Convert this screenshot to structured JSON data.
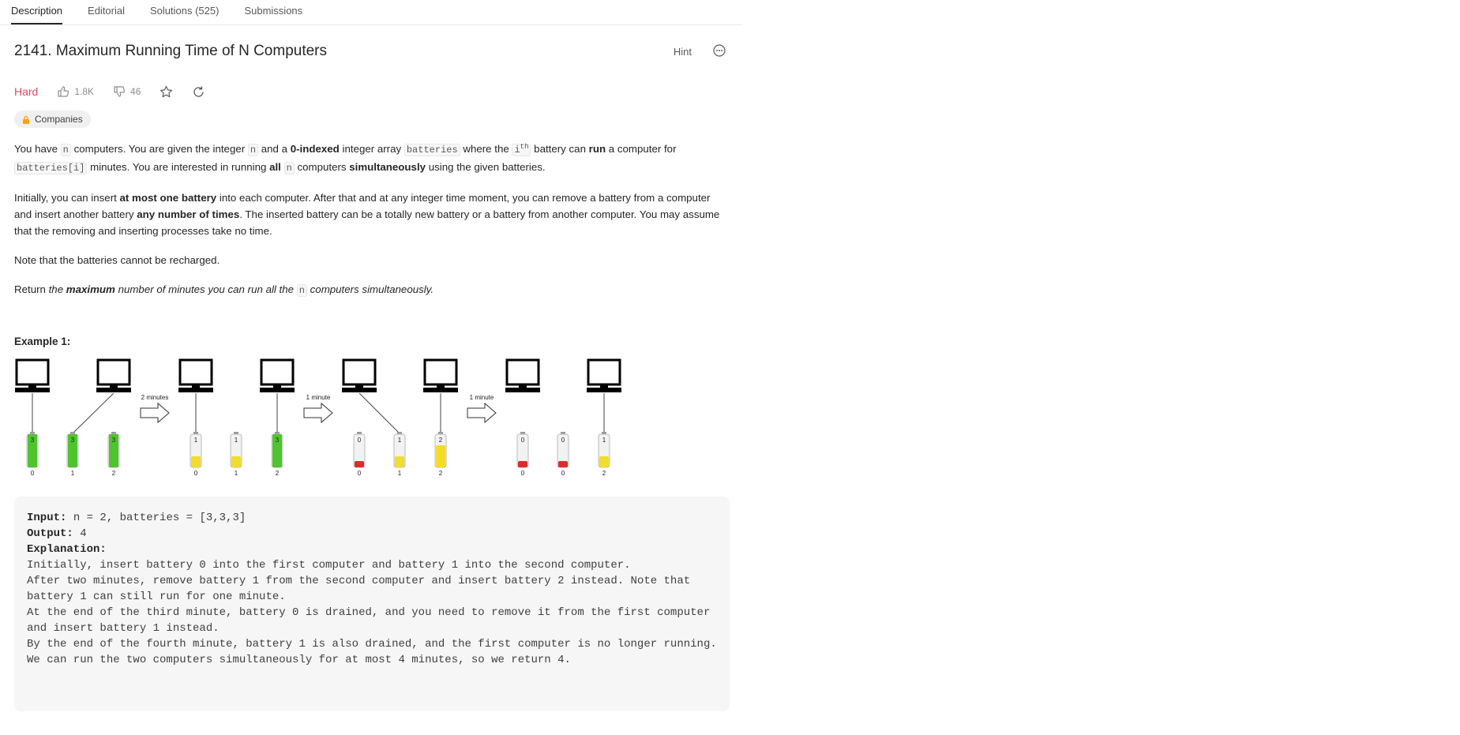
{
  "tabs": [
    {
      "label": "Description",
      "active": true
    },
    {
      "label": "Editorial",
      "active": false
    },
    {
      "label": "Solutions (525)",
      "active": false
    },
    {
      "label": "Submissions",
      "active": false
    }
  ],
  "problem": {
    "title": "2141. Maximum Running Time of N Computers",
    "hint_label": "Hint",
    "difficulty": "Hard",
    "likes": "1.8K",
    "dislikes": "46",
    "companies_label": "Companies"
  },
  "description": {
    "p1": {
      "t1": "You have ",
      "c1": "n",
      "t2": " computers. You are given the integer ",
      "c2": "n",
      "t3": " and a ",
      "b1": "0-indexed",
      "t4": " integer array ",
      "c3": "batteries",
      "t5": " where the ",
      "c4_base": "i",
      "c4_sup": "th",
      "t6": " battery can ",
      "b2": "run",
      "t7": " a computer for ",
      "c5": "batteries[i]",
      "t8": " minutes. You are interested in running ",
      "b3": "all",
      "t9": " ",
      "c6": "n",
      "t10": " computers ",
      "b4": "simultaneously",
      "t11": " using the given batteries."
    },
    "p2": {
      "t1": "Initially, you can insert ",
      "b1": "at most one battery",
      "t2": " into each computer. After that and at any integer time moment, you can remove a battery from a computer and insert another battery ",
      "b2": "any number of times",
      "t3": ". The inserted battery can be a totally new battery or a battery from another computer. You may assume that the removing and inserting processes take no time."
    },
    "p3": "Note that the batteries cannot be recharged.",
    "p4": {
      "t1": "Return ",
      "i1": "the ",
      "b1": "maximum",
      "i2": " number of minutes you can run all the ",
      "c1": "n",
      "i3": " computers simultaneously."
    }
  },
  "example": {
    "title": "Example 1:",
    "input_label": "Input:",
    "input_value": " n = 2, batteries = [3,3,3]",
    "output_label": "Output:",
    "output_value": " 4",
    "explanation_label": "Explanation:",
    "explanation_text": "Initially, insert battery 0 into the first computer and battery 1 into the second computer.\nAfter two minutes, remove battery 1 from the second computer and insert battery 2 instead. Note that battery 1 can still run for one minute.\nAt the end of the third minute, battery 0 is drained, and you need to remove it from the first computer and insert battery 1 instead.\nBy the end of the fourth minute, battery 1 is also drained, and the first computer is no longer running.\nWe can run the two computers simultaneously for at most 4 minutes, so we return 4."
  },
  "figure": {
    "arrow_labels": [
      "2 minutes",
      "1 minute",
      "1 minute"
    ],
    "stages": [
      {
        "batteries": [
          {
            "id": "0",
            "charge": "3",
            "level": 3
          },
          {
            "id": "1",
            "charge": "3",
            "level": 3
          },
          {
            "id": "2",
            "charge": "3",
            "level": 3
          }
        ]
      },
      {
        "batteries": [
          {
            "id": "0",
            "charge": "1",
            "level": 1
          },
          {
            "id": "1",
            "charge": "1",
            "level": 1
          },
          {
            "id": "2",
            "charge": "3",
            "level": 3
          }
        ]
      },
      {
        "batteries": [
          {
            "id": "0",
            "charge": "0",
            "level": 0
          },
          {
            "id": "1",
            "charge": "1",
            "level": 1
          },
          {
            "id": "2",
            "charge": "2",
            "level": 2
          }
        ]
      },
      {
        "batteries": [
          {
            "id": "0",
            "charge": "0",
            "level": 0
          },
          {
            "id": "0",
            "charge": "0",
            "level": 0
          },
          {
            "id": "2",
            "charge": "1",
            "level": 1
          }
        ]
      }
    ],
    "colors": {
      "full": "#4fc42f",
      "partial": "#f2dd2a",
      "empty": "#e02b2b",
      "outline": "#000000"
    }
  }
}
